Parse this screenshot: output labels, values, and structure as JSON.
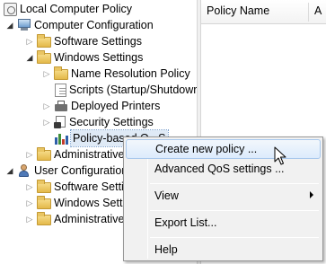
{
  "tree": {
    "root": {
      "label": "Local Computer Policy",
      "icon": "scroll-icon"
    },
    "computer_config": {
      "label": "Computer Configuration",
      "icon": "computer-icon",
      "expanded": true
    },
    "software_settings": {
      "label": "Software Settings",
      "icon": "folder-icon"
    },
    "windows_settings": {
      "label": "Windows Settings",
      "icon": "folder-icon",
      "expanded": true
    },
    "name_resolution": {
      "label": "Name Resolution Policy",
      "icon": "folder-icon"
    },
    "scripts": {
      "label": "Scripts (Startup/Shutdowr",
      "icon": "document-icon"
    },
    "deployed_printers": {
      "label": "Deployed Printers",
      "icon": "printer-icon"
    },
    "security_settings": {
      "label": "Security Settings",
      "icon": "security-icon"
    },
    "policy_based_qos": {
      "label": "Policy-based Q...S",
      "icon": "bar-chart-icon",
      "selected": true
    },
    "admin_templates_1": {
      "label": "Administrative",
      "icon": "folder-icon"
    },
    "user_config": {
      "label": "User Configuration",
      "icon": "user-icon",
      "expanded": true
    },
    "user_software_settings": {
      "label": "Software Settin",
      "icon": "folder-icon"
    },
    "user_windows_settings": {
      "label": "Windows Settin",
      "icon": "folder-icon"
    },
    "admin_templates_2": {
      "label": "Administrative",
      "icon": "folder-icon"
    }
  },
  "list": {
    "col_policy_name": "Policy Name",
    "col_next": "A"
  },
  "context_menu": {
    "items": [
      {
        "label": "Create new policy ...",
        "hot": true
      },
      {
        "label": "Advanced QoS settings ..."
      },
      {
        "label": "View",
        "submenu": true
      },
      {
        "label": "Export List..."
      },
      {
        "label": "Help"
      }
    ]
  },
  "colors": {
    "menu_bg": "#f1f1f1",
    "hover_border": "#a8c8ec",
    "folder": "#e4b94a"
  }
}
